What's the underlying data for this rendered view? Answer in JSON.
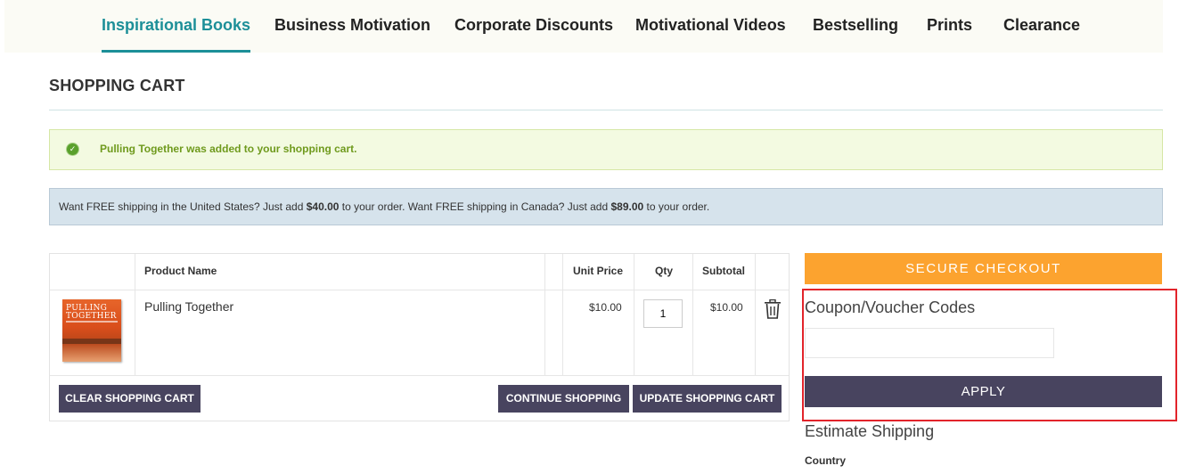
{
  "nav": {
    "items": [
      {
        "label": "Inspirational Books",
        "active": true
      },
      {
        "label": "Business Motivation"
      },
      {
        "label": "Corporate Discounts"
      },
      {
        "label": "Motivational Videos"
      },
      {
        "label": "Bestselling"
      },
      {
        "label": "Prints"
      },
      {
        "label": "Clearance"
      }
    ]
  },
  "page": {
    "title": "SHOPPING CART"
  },
  "messages": {
    "success": "Pulling Together was added to your shopping cart.",
    "shipping": {
      "part1": "Want FREE shipping in the United States? Just add ",
      "us_amount": "$40.00",
      "part2": " to your order. Want FREE shipping in Canada? Just add ",
      "ca_amount": "$89.00",
      "part3": " to your order."
    }
  },
  "cart": {
    "headers": {
      "product": "Product Name",
      "unit_price": "Unit Price",
      "qty": "Qty",
      "subtotal": "Subtotal"
    },
    "items": [
      {
        "name": "Pulling Together",
        "cover_text": "PULLING TOGETHER",
        "unit_price": "$10.00",
        "qty": "1",
        "subtotal": "$10.00"
      }
    ],
    "buttons": {
      "clear": "CLEAR SHOPPING CART",
      "continue": "CONTINUE SHOPPING",
      "update": "UPDATE SHOPPING CART"
    }
  },
  "sidebar": {
    "checkout": "SECURE CHECKOUT",
    "coupon_title": "Coupon/Voucher Codes",
    "coupon_value": "",
    "apply": "APPLY",
    "estimate_title": "Estimate Shipping",
    "country_label": "Country"
  },
  "colors": {
    "accent": "#1c8f98",
    "checkout": "#fca32f",
    "button": "#48445f",
    "highlight": "#e2242b"
  },
  "icons": {
    "success": "check-circle-icon",
    "remove": "trash-icon"
  }
}
